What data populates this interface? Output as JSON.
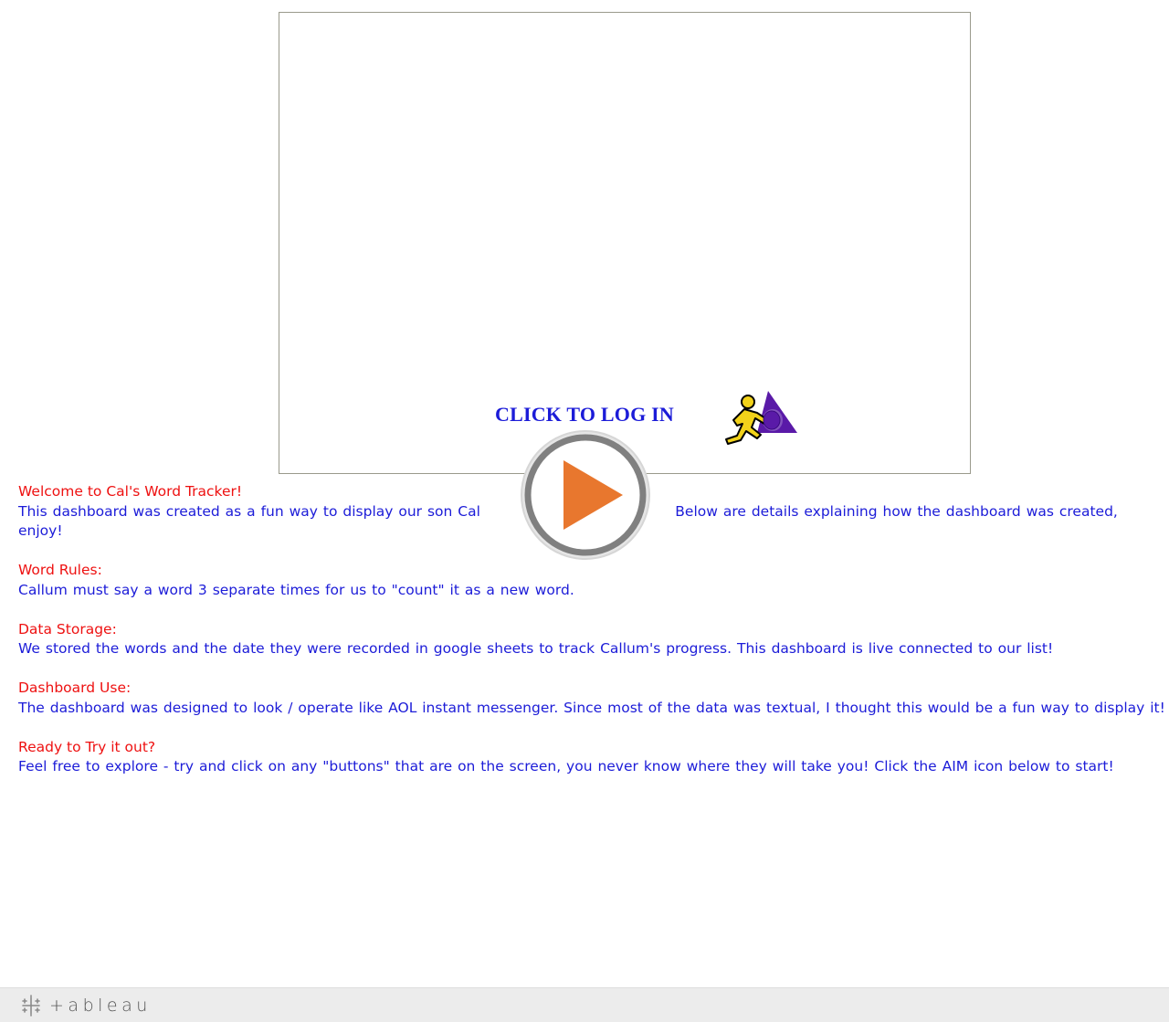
{
  "login": {
    "label": "CLICK TO LOG IN",
    "icon": "aim-running-man-icon"
  },
  "intro": {
    "heading": "Welcome to Cal's Word Tracker!",
    "body": "This dashboard was created as a fun way to display our son Cal                                    Below are details explaining how the dashboard was created, enjoy!"
  },
  "word_rules": {
    "heading": "Word Rules:",
    "body": "Callum must say a word 3 separate times for us to \"count\" it as a new word."
  },
  "data_storage": {
    "heading": "Data Storage:",
    "body": "We stored the words and the date they were recorded in google sheets to track Callum's progress. This dashboard is live connected to our list!"
  },
  "dashboard_use": {
    "heading": "Dashboard Use:",
    "body": "The dashboard was designed to look / operate like AOL instant messenger. Since most of the data was textual, I thought this would be a fun way to display it!"
  },
  "try_it": {
    "heading": "Ready to Try it out?",
    "body": "Feel free to explore - try and click on any \"buttons\" that are on the screen, you never know where they will take you! Click the AIM icon below to start!"
  },
  "overlay": {
    "icon": "play-icon"
  },
  "footer": {
    "brand": "+ableau",
    "icon": "tableau-cross-icon"
  },
  "colors": {
    "heading": "#ee1111",
    "body": "#1c1cd8",
    "play_orange": "#e8772e",
    "aim_yellow": "#f2d21a",
    "aim_purple": "#5a1aa8"
  }
}
